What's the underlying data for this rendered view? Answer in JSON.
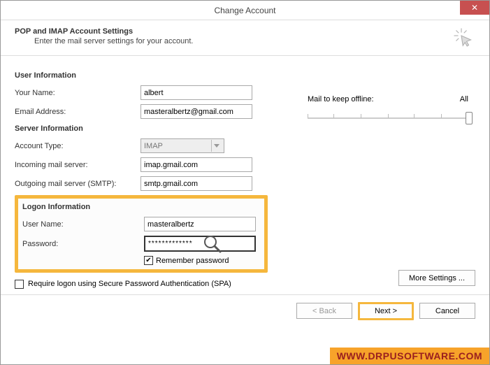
{
  "window": {
    "title": "Change Account"
  },
  "header": {
    "title": "POP and IMAP Account Settings",
    "subtitle": "Enter the mail server settings for your account."
  },
  "sections": {
    "user_info": "User Information",
    "server_info": "Server Information",
    "logon_info": "Logon Information"
  },
  "labels": {
    "your_name": "Your Name:",
    "email": "Email Address:",
    "account_type": "Account Type:",
    "incoming": "Incoming mail server:",
    "outgoing": "Outgoing mail server (SMTP):",
    "username": "User Name:",
    "password": "Password:",
    "remember": "Remember password",
    "spa": "Require logon using Secure Password Authentication (SPA)",
    "mail_offline": "Mail to keep offline:",
    "mail_offline_value": "All"
  },
  "values": {
    "your_name": "albert",
    "email": "masteralbertz@gmail.com",
    "account_type": "IMAP",
    "incoming": "imap.gmail.com",
    "outgoing": "smtp.gmail.com",
    "username": "masteralbertz",
    "password": "*************",
    "remember_checked": true,
    "spa_checked": false
  },
  "buttons": {
    "more_settings": "More Settings ...",
    "back": "< Back",
    "next": "Next >",
    "cancel": "Cancel"
  },
  "watermark": "WWW.DRPUSOFTWARE.COM"
}
